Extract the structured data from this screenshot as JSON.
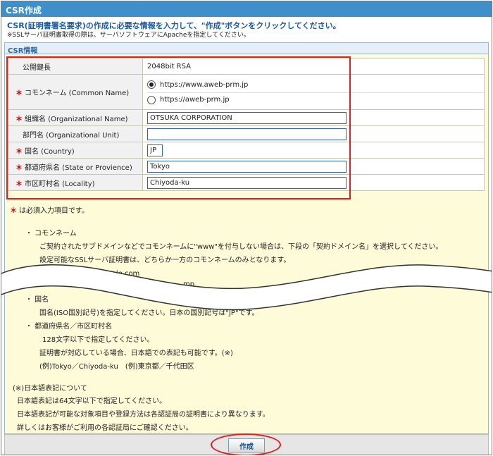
{
  "header": {
    "title": "CSR作成"
  },
  "intro": {
    "line1": "CSR(証明書署名要求)の作成に必要な情報を入力して、\"作成\"ボタンをクリックしてください。",
    "line2": "※SSLサーバ証明書取得の際は、サーバソフトウェアにApacheを指定してください。"
  },
  "section": {
    "title": "CSR情報"
  },
  "form": {
    "required_mark": "＊",
    "public_key": {
      "label": "公開鍵長",
      "value": "2048bit RSA"
    },
    "common_name": {
      "label": "コモンネーム (Common Name)",
      "options": [
        "https://www.aweb-prm.jp",
        "https://aweb-prm.jp"
      ],
      "selected_index": 0
    },
    "organization": {
      "label": "組織名 (Organizational Name)",
      "value": "OTSUKA CORPORATION"
    },
    "unit": {
      "label": "部門名 (Organizational Unit)",
      "value": ""
    },
    "country": {
      "label": "国名 (Country)",
      "value": "JP"
    },
    "state": {
      "label": "都道府県名 (State or Provience)",
      "value": "Tokyo"
    },
    "locality": {
      "label": "市区町村名 (Locality)",
      "value": "Chiyoda-ku"
    }
  },
  "notes": {
    "required_note": "は必須入力項目です。",
    "common_name_heading": "・ コモンネーム",
    "common_name_desc1": "ご契約されたサブドメインなどでコモンネームに\"www\"を付与しない場合は、下段の「契約ドメイン名」を選択してください。",
    "common_name_desc2": "設定可能なSSLサーバ証明書は、どちらか一方のコモンネームのみとなります。",
    "common_name_example": "(例)https://sub.example.com",
    "cut_fragment": "mp",
    "country_heading": "・ 国名",
    "country_desc": "国名(ISO国別記号)を指定してください。日本の国別記号は\"JP\"です。",
    "state_heading": "・ 都道府県名／市区町村名",
    "state_desc1": "128文字以下で指定してください。",
    "state_desc2": "証明書が対応している場合、日本語での表記も可能です。(※)",
    "state_example": "(例)Tokyo／Chiyoda-ku　(例)東京都／千代田区",
    "jp_heading": "(※)日本語表記について",
    "jp_desc1": "日本語表記は64文字以下で指定してください。",
    "jp_desc2": "日本語表記が可能な対象項目や登録方法は各認証局の証明書により異なります。",
    "jp_desc3": "詳しくはお客様がご利用の各認証局にご確認ください。"
  },
  "footer": {
    "submit_label": "作成"
  },
  "colors": {
    "title_bar": "#3f8fc9",
    "highlight": "#e02020",
    "panel": "#fdfbd8"
  }
}
